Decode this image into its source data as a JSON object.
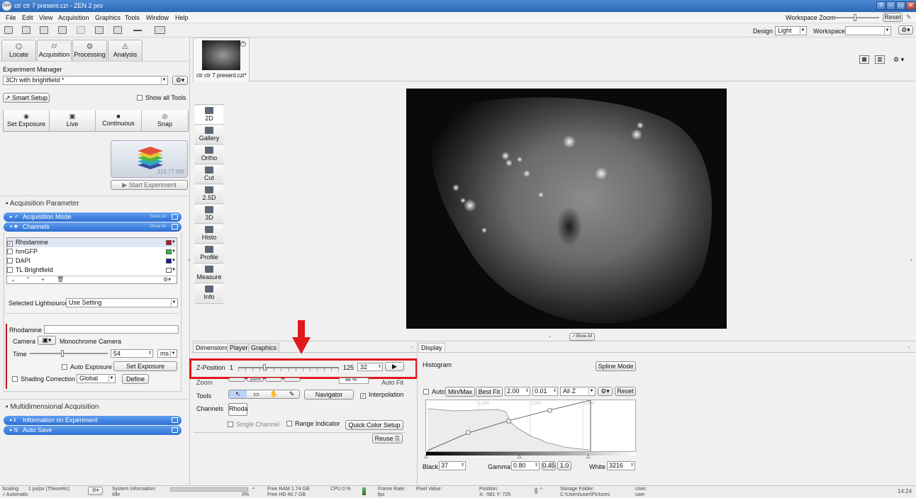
{
  "window": {
    "title": "ctr ctr 7 present.czi - ZEN 2 pro",
    "logo_text": "ZEN",
    "buttons": [
      "?",
      "–",
      "▭",
      "✕"
    ]
  },
  "menu": {
    "items": [
      "File",
      "Edit",
      "View",
      "Acquisition",
      "Graphics",
      "Tools",
      "Window",
      "Help"
    ],
    "workspace_zoom_label": "Workspace Zoom",
    "reset_label": "Reset"
  },
  "toolbar": {
    "design_label": "Design",
    "design_value": "Light",
    "workspace_label": "Workspace",
    "workspace_value": ""
  },
  "left": {
    "tabs": [
      "Locate",
      "Acquisition",
      "Processing",
      "Analysis"
    ],
    "active_tab": "Acquisition",
    "experiment_manager_label": "Experiment Manager",
    "experiment_value": "3Ch with brightfield *",
    "smart_setup": "Smart Setup",
    "show_all_tools": "Show all Tools",
    "acq_buttons": [
      "Set Exposure",
      "Live",
      "Continuous",
      "Snap"
    ],
    "experiment_size": "318.77 MB",
    "start_experiment": "Start Experiment",
    "acq_param_header": "Acquisition Parameter",
    "acq_mode": "Acquisition Mode",
    "channels_bar": "Channels",
    "show_all": "Show All",
    "channels": [
      {
        "name": "Rhodamine",
        "checked": true,
        "color": "#c0141a"
      },
      {
        "name": "hmGFP",
        "checked": false,
        "color": "#2cc24a"
      },
      {
        "name": "DAPI",
        "checked": false,
        "color": "#1a1aa8"
      },
      {
        "name": "TL Brightfield",
        "checked": false,
        "color": "#ffffff"
      }
    ],
    "lightsource_label": "Selected Lightsource",
    "lightsource_value": "Use Setting",
    "rhodamine_label": "Rhodamine",
    "camera_label": "Camera",
    "camera_value": "Monochrome Camera",
    "time_label": "Time",
    "time_value": "54",
    "time_unit": "ms",
    "auto_exposure": "Auto Exposure",
    "set_exposure": "Set Exposure",
    "shading_correction": "Shading Correction",
    "shading_value": "Global",
    "define": "Define",
    "multi_header": "Multidimensional Acquisition",
    "info_experiment": "Information on Experiment",
    "auto_save": "Auto Save"
  },
  "doc": {
    "thumb_label": "ctr ctr 7 present.czi*"
  },
  "view_tabs": [
    "2D",
    "Gallery",
    "Ortho",
    "Cut",
    "2.5D",
    "3D",
    "Histo",
    "Profile",
    "Measure",
    "Info"
  ],
  "show_all_small": "Show All",
  "dims": {
    "tabs": [
      "Dimensions",
      "Player",
      "Graphics"
    ],
    "zpos_label": "Z-Position",
    "zpos_min": "1",
    "zpos_max": "125",
    "zpos_value": "32",
    "zpos_fraction": 0.25,
    "zoom_label": "Zoom",
    "zoom_pct": "100%",
    "zoom_value": "48 %",
    "auto_fit": "Auto Fit",
    "tools_label": "Tools",
    "navigator": "Navigator",
    "interpolation": "Interpolation",
    "channels_label": "Channels",
    "channel_chip": "Rhoda",
    "single_channel": "Single Channel",
    "range_indicator": "Range Indicator",
    "quick_color": "Quick Color Setup",
    "reuse": "Reuse"
  },
  "display": {
    "tab": "Display",
    "histogram": "Histogram",
    "spline_mode": "Spline Mode",
    "auto": "Auto",
    "minmax": "Min/Max",
    "bestfit": "Best Fit",
    "val1": "2.00",
    "val2": "0.01",
    "allz": "All Z",
    "reset": "Reset",
    "hist_labels": [
      "1,000",
      "1,000",
      "1,000"
    ],
    "black_label": "Black",
    "black_value": "37",
    "gamma_label": "Gamma",
    "gamma_value": "0.80",
    "gamma_a": "0.45",
    "gamma_b": "1.0",
    "white_label": "White",
    "white_value": "3216"
  },
  "status": {
    "scaling_label": "Scaling",
    "scaling_value": "1 px/px (Theoretic)",
    "scaling_auto": "Automatic",
    "sysinfo_label": "System Information:",
    "sysinfo_value": "Idle",
    "pct": "0%",
    "ram": "Free RAM 1.74 GB",
    "hd": "Free HD 40.7 GB",
    "cpu": "CPU 0 %",
    "frame_rate_label": "Frame Rate:",
    "frame_rate_value": "fps",
    "pixel_value_label": "Pixel Value:",
    "position_label": "Position:",
    "position_value": "X: -581  Y: 725",
    "storage_label": "Storage Folder:",
    "storage_value": "C:\\Users\\user\\Pictures",
    "user_label": "User:",
    "user_value": "user",
    "time": "14:24"
  },
  "colors": {
    "accent_blue": "#2f6fd3",
    "highlight_red": "#e0181c"
  }
}
